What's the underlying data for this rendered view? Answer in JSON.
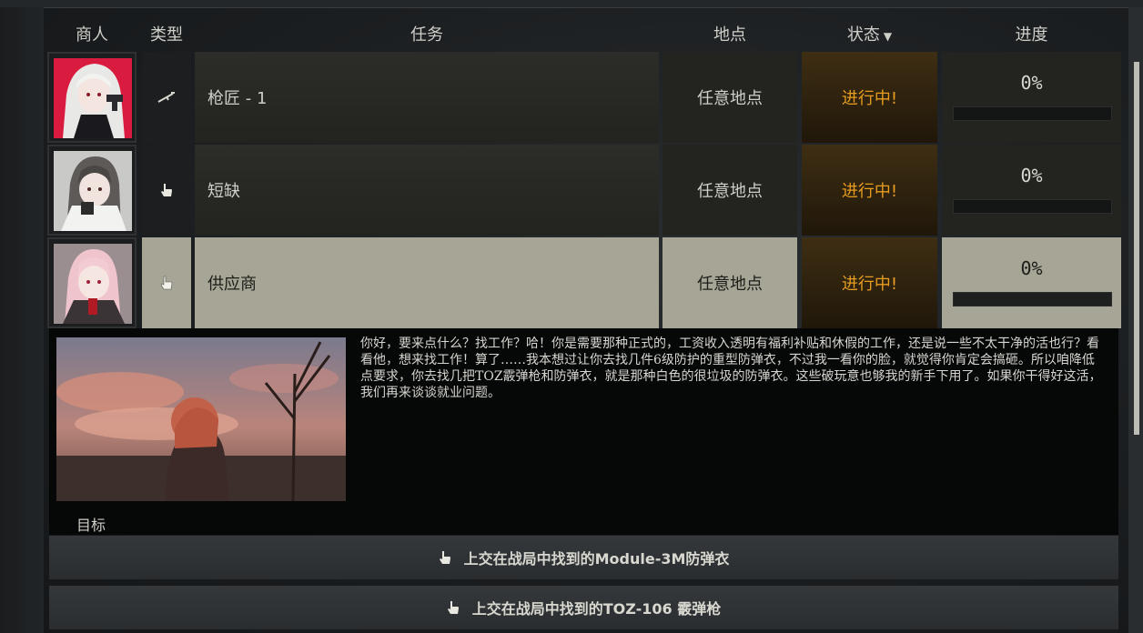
{
  "headers": {
    "trader": "商人",
    "type": "类型",
    "task": "任务",
    "location": "地点",
    "status": "状态",
    "progress": "进度"
  },
  "quests": [
    {
      "type_icon": "rifle-icon",
      "name": "枪匠 - 1",
      "location": "任意地点",
      "status": "进行中!",
      "progress": "0%",
      "progress_value": 0
    },
    {
      "type_icon": "hand-pointer-icon",
      "name": "短缺",
      "location": "任意地点",
      "status": "进行中!",
      "progress": "0%",
      "progress_value": 0
    },
    {
      "type_icon": "hand-pointer-icon",
      "name": "供应商",
      "location": "任意地点",
      "status": "进行中!",
      "progress": "0%",
      "progress_value": 0,
      "selected": true
    }
  ],
  "detail": {
    "description": "你好，要来点什么？找工作？哈！你是需要那种正式的，工资收入透明有福利补贴和休假的工作，还是说一些不太干净的活也行？看看他，想来找工作！算了……我本想过让你去找几件6级防护的重型防弹衣，不过我一看你的脸，就觉得你肯定会搞砸。所以咱降低点要求，你去找几把TOZ霰弹枪和防弹衣，就是那种白色的很垃圾的防弹衣。这些破玩意也够我的新手下用了。如果你干得好这活，我们再来谈谈就业问题。",
    "objectives_label": "目标",
    "objectives": [
      "上交在战局中找到的Module-3M防弹衣",
      "上交在战局中找到的TOZ-106 霰弹枪"
    ]
  },
  "colors": {
    "status_active": "#e89d1f",
    "selected_row": "#a6a596"
  }
}
